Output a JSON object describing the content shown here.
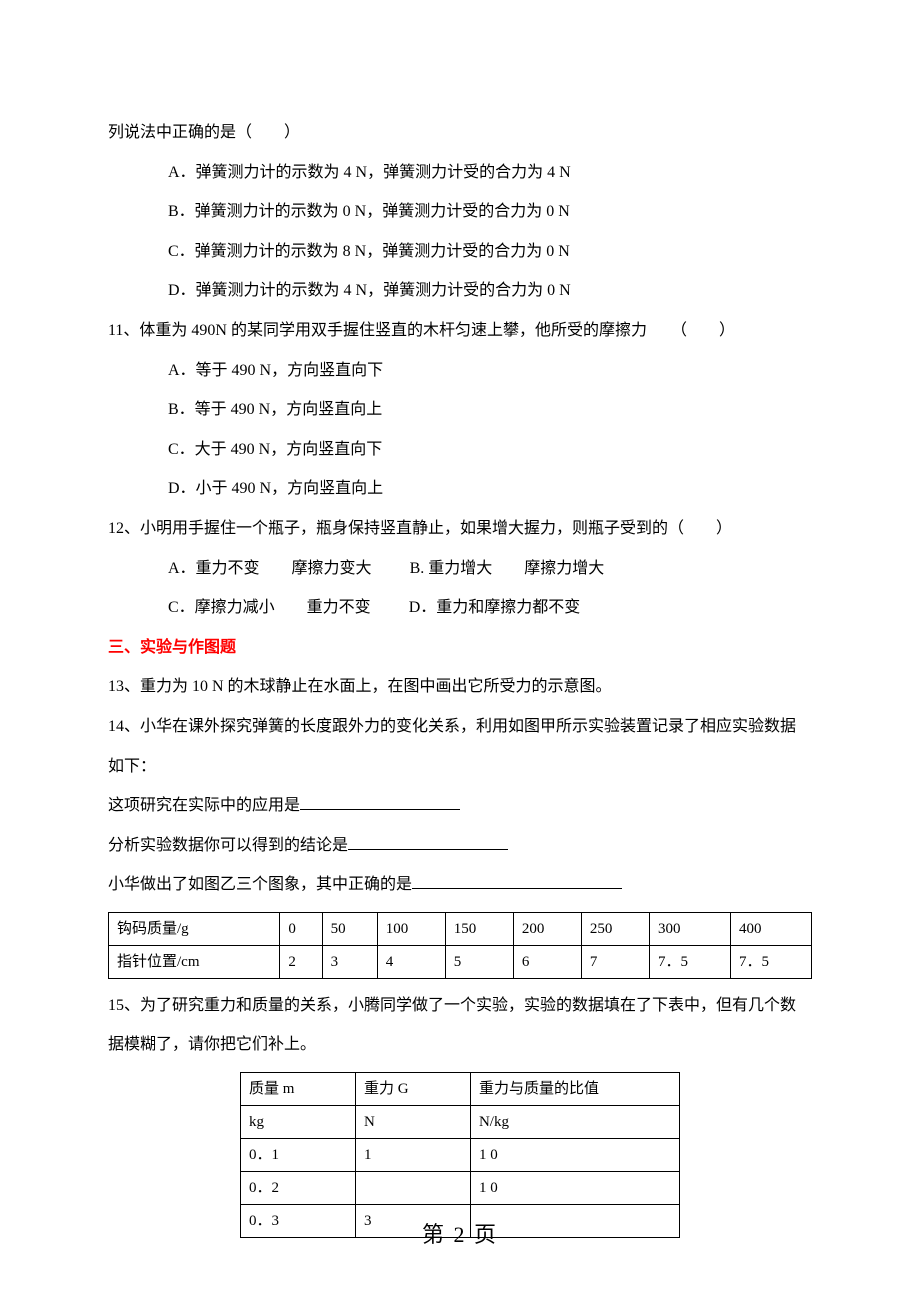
{
  "q10": {
    "stem": "列说法中正确的是（　　）",
    "a": "A．弹簧测力计的示数为 4 N，弹簧测力计受的合力为 4 N",
    "b": "B．弹簧测力计的示数为 0 N，弹簧测力计受的合力为 0 N",
    "c": "C．弹簧测力计的示数为 8 N，弹簧测力计受的合力为 0 N",
    "d": "D．弹簧测力计的示数为 4 N，弹簧测力计受的合力为 0 N"
  },
  "q11": {
    "stem": "11、体重为 490N 的某同学用双手握住竖直的木杆匀速上攀，他所受的摩擦力　　（　　）",
    "a": "A．等于 490 N，方向竖直向下",
    "b": "B．等于 490 N，方向竖直向上",
    "c": "C．大于 490 N，方向竖直向下",
    "d": "D．小于 490 N，方向竖直向上"
  },
  "q12": {
    "stem": "12、小明用手握住一个瓶子，瓶身保持竖直静止，如果增大握力，则瓶子受到的（　　）",
    "a": "A．重力不变　　摩擦力变大",
    "b": "B. 重力增大　　摩擦力增大",
    "c": "C．摩擦力减小　　重力不变",
    "d": "D．重力和摩擦力都不变"
  },
  "section3": "三、实验与作图题",
  "q13": "13、重力为 10 N 的木球静止在水面上，在图中画出它所受力的示意图。",
  "q14": {
    "l1": "14、小华在课外探究弹簧的长度跟外力的变化关系，利用如图甲所示实验装置记录了相应实验数据",
    "l2": "如下：",
    "l3": "这项研究在实际中的应用是",
    "l4": "分析实验数据你可以得到的结论是",
    "l5": "小华做出了如图乙三个图象，其中正确的是",
    "thead1": "钩码质量/g",
    "thead2": "指针位置/cm",
    "r1": [
      "0",
      "50",
      "100",
      "150",
      "200",
      "250",
      "300",
      "400"
    ],
    "r2": [
      "2",
      "3",
      "4",
      "5",
      "6",
      "7",
      "7．5",
      "7．5"
    ]
  },
  "q15": {
    "l1": "15、为了研究重力和质量的关系，小腾同学做了一个实验，实验的数据填在了下表中，但有几个数",
    "l2": "据模糊了，请你把它们补上。",
    "h1a": "质量 m",
    "h1b": "重力 G",
    "h1c": "重力与质量的比值",
    "h2a": "kg",
    "h2b": "N",
    "h2c": "N/kg",
    "rows": [
      [
        "0．1",
        "1",
        "1 0"
      ],
      [
        "0．2",
        "",
        "1 0"
      ],
      [
        "0．3",
        "3",
        ""
      ]
    ]
  },
  "footer": "第 2 页"
}
